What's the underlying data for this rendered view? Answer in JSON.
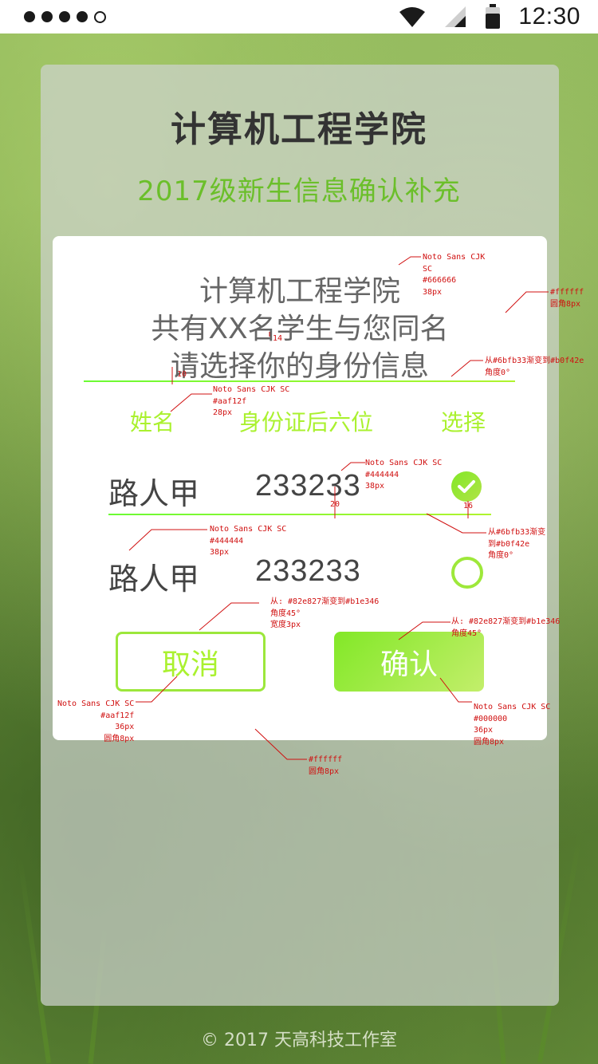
{
  "status_bar": {
    "time": "12:30",
    "signal_dots": [
      "filled",
      "filled",
      "filled",
      "filled",
      "empty"
    ],
    "icons": [
      "wifi-icon",
      "cell-signal-icon",
      "battery-icon"
    ]
  },
  "header": {
    "title": "计算机工程学院",
    "subtitle": "2017级新生信息确认补充"
  },
  "dialog": {
    "message_lines": [
      "计算机工程学院",
      "共有XX名学生与您同名",
      "请选择你的身份信息"
    ],
    "columns": [
      "姓名",
      "身份证后六位",
      "选择"
    ],
    "rows": [
      {
        "name": "路人甲",
        "id_last6": "233233",
        "selected": true
      },
      {
        "name": "路人甲",
        "id_last6": "233233",
        "selected": false
      }
    ],
    "cancel_label": "取消",
    "confirm_label": "确认"
  },
  "footer": "© 2017 天高科技工作室",
  "annotations": {
    "a1": "Noto Sans CJK\nSC\n#666666\n38px",
    "a2": "#ffffff\n圆角8px",
    "a3": "14",
    "a4": "10",
    "a5": "从#6bfb33渐变到#b0f42e\n角度0°",
    "a6": "Noto Sans CJK SC\n#aaf12f\n28px",
    "a7": "Noto Sans CJK SC\n#444444\n38px",
    "a8": "20",
    "a9": "16",
    "a10": "从#6bfb33渐变\n到#b0f42e\n角度0°",
    "a11": "Noto Sans CJK SC\n#444444\n38px",
    "a12": "从: #82e827渐变到#b1e346\n角度45°\n宽度3px",
    "a13": "从: #82e827渐变到#b1e346\n角度45°",
    "a14": "Noto Sans CJK SC\n#aaf12f\n36px\n圆角8px",
    "a15": "Noto Sans CJK SC\n#000000\n36px\n圆角8px",
    "a16": "#ffffff\n圆角8px"
  },
  "colors": {
    "accent_green": "#aaf12f",
    "gradient_start": "#6bfb33",
    "gradient_end": "#b0f42e",
    "text_dark": "#444444",
    "text_gray": "#666666",
    "annotation_red": "#d01010"
  }
}
